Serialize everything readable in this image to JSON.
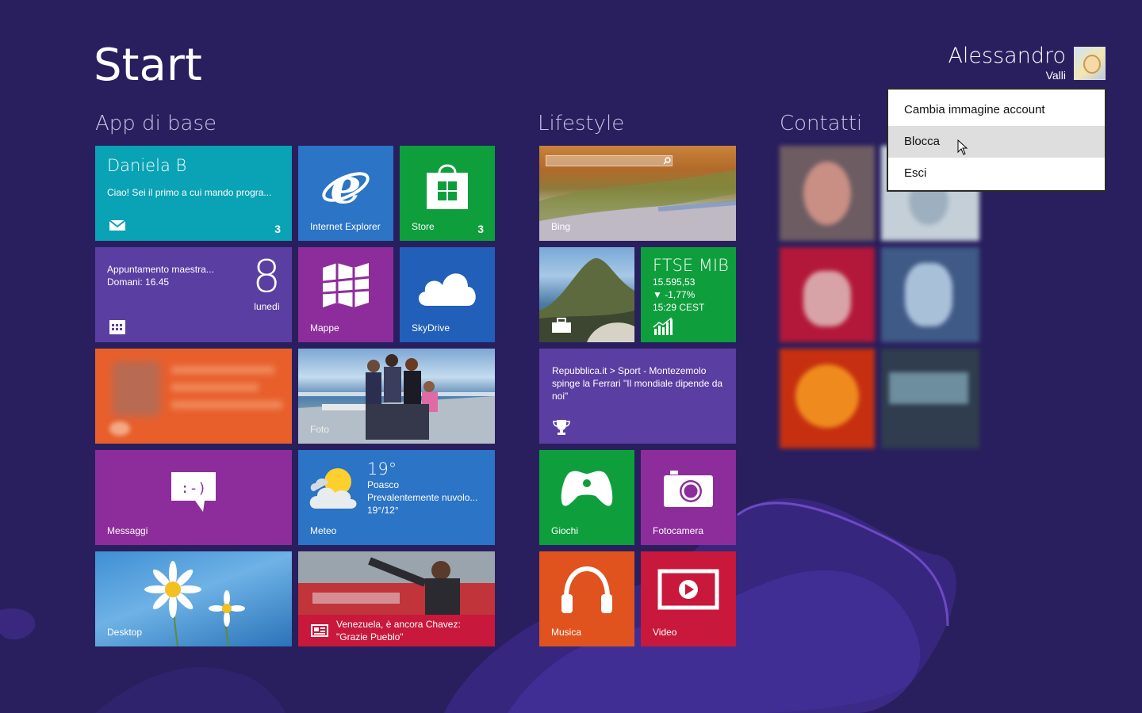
{
  "screen": {
    "title": "Start"
  },
  "user": {
    "first_name": "Alessandro",
    "last_name": "Valli"
  },
  "groups": {
    "base": "App di base",
    "lifestyle": "Lifestyle",
    "contacts": "Contatti"
  },
  "tiles": {
    "mail": {
      "name": "Daniela B",
      "message": "Ciao! Sei il primo a cui mando progra...",
      "badge": "3",
      "color": "#0aa2b5"
    },
    "ie": {
      "label": "Internet Explorer",
      "color": "#2b74c6"
    },
    "store": {
      "label": "Store",
      "badge": "3",
      "color": "#0e9f3c"
    },
    "calendar": {
      "event": "Appuntamento maestra...",
      "time": "Domani: 16.45",
      "day_number": "8",
      "day_name": "lunedì",
      "color": "#5b3ea2"
    },
    "maps": {
      "label": "Mappe",
      "color": "#8d2d9c"
    },
    "skydrive": {
      "label": "SkyDrive",
      "color": "#215fb8"
    },
    "people": {
      "color": "#e85f2c"
    },
    "photos": {
      "label": "Foto"
    },
    "messages": {
      "label": "Messaggi",
      "color": "#8d2d9c"
    },
    "weather": {
      "temperature": "19°",
      "location": "Poasco",
      "condition": "Prevalentemente nuvolo...",
      "range": "19°/12°",
      "label": "Meteo",
      "color": "#2b74c6"
    },
    "desktop": {
      "label": "Desktop"
    },
    "news": {
      "headline": "Venezuela, è ancora Chavez: \"Grazie Pueblo\"",
      "color": "#c8183c"
    },
    "bing": {
      "label": "Bing"
    },
    "finance": {
      "index": "FTSE MIB",
      "value": "15.595,53",
      "change": "▼ -1,77%",
      "time": "15:29 CEST",
      "color": "#0e9f3c"
    },
    "sport": {
      "headline": "Repubblica.it > Sport - Montezemolo spinge la Ferrari \"Il mondiale dipende da noi\"",
      "color": "#5b3ea2"
    },
    "games": {
      "label": "Giochi",
      "color": "#0e9f3c"
    },
    "camera": {
      "label": "Fotocamera",
      "color": "#8d2d9c"
    },
    "music": {
      "label": "Musica",
      "color": "#e0531e"
    },
    "video": {
      "label": "Video",
      "color": "#c8183c"
    }
  },
  "context_menu": {
    "items": [
      "Cambia immagine account",
      "Blocca",
      "Esci"
    ],
    "hovered_index": 1
  }
}
